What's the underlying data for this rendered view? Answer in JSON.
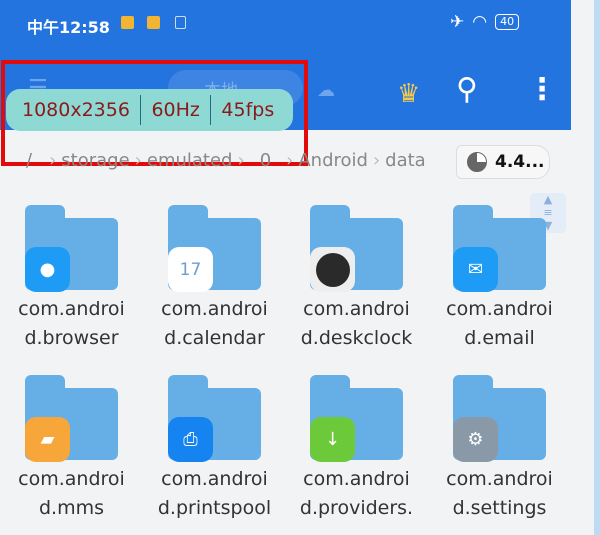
{
  "status_bar": {
    "time": "中午12:58",
    "battery": "40",
    "airplane_icon": "airplane-icon",
    "wifi_icon": "wifi-icon"
  },
  "toolbar": {
    "menu_icon": "menu-icon",
    "tab_local": "本地",
    "crown_icon": "crown-icon",
    "search_icon": "search-icon",
    "more_icon": "more-vert-icon"
  },
  "overlay": {
    "resolution": "1080x2356",
    "refresh": "60Hz",
    "fps": "45fps"
  },
  "breadcrumb": [
    "/",
    "storage",
    "emulated",
    "0",
    "Android",
    "data"
  ],
  "storage_chip": {
    "icon": "pie-chart-icon",
    "label": "4.4..."
  },
  "folders": [
    {
      "line1": "com.androi",
      "line2": "d.browser",
      "icon": "browser-icon",
      "color": "#1e9bf5"
    },
    {
      "line1": "com.androi",
      "line2": "d.calendar",
      "icon": "calendar-icon",
      "color": "#ffffff",
      "badge": "17"
    },
    {
      "line1": "com.androi",
      "line2": "d.deskclock",
      "icon": "clock-icon",
      "color": "#eeeeee"
    },
    {
      "line1": "com.androi",
      "line2": "d.email",
      "icon": "email-icon",
      "color": "#1e9bf5"
    },
    {
      "line1": "com.androi",
      "line2": "d.mms",
      "icon": "message-icon",
      "color": "#f7a63a"
    },
    {
      "line1": "com.androi",
      "line2": "d.printspool",
      "icon": "printer-icon",
      "color": "#1583f0"
    },
    {
      "line1": "com.androi",
      "line2": "d.providers.",
      "icon": "download-icon",
      "color": "#6cc93a"
    },
    {
      "line1": "com.androi",
      "line2": "d.settings",
      "icon": "settings-icon",
      "color": "#8a99a8"
    }
  ]
}
